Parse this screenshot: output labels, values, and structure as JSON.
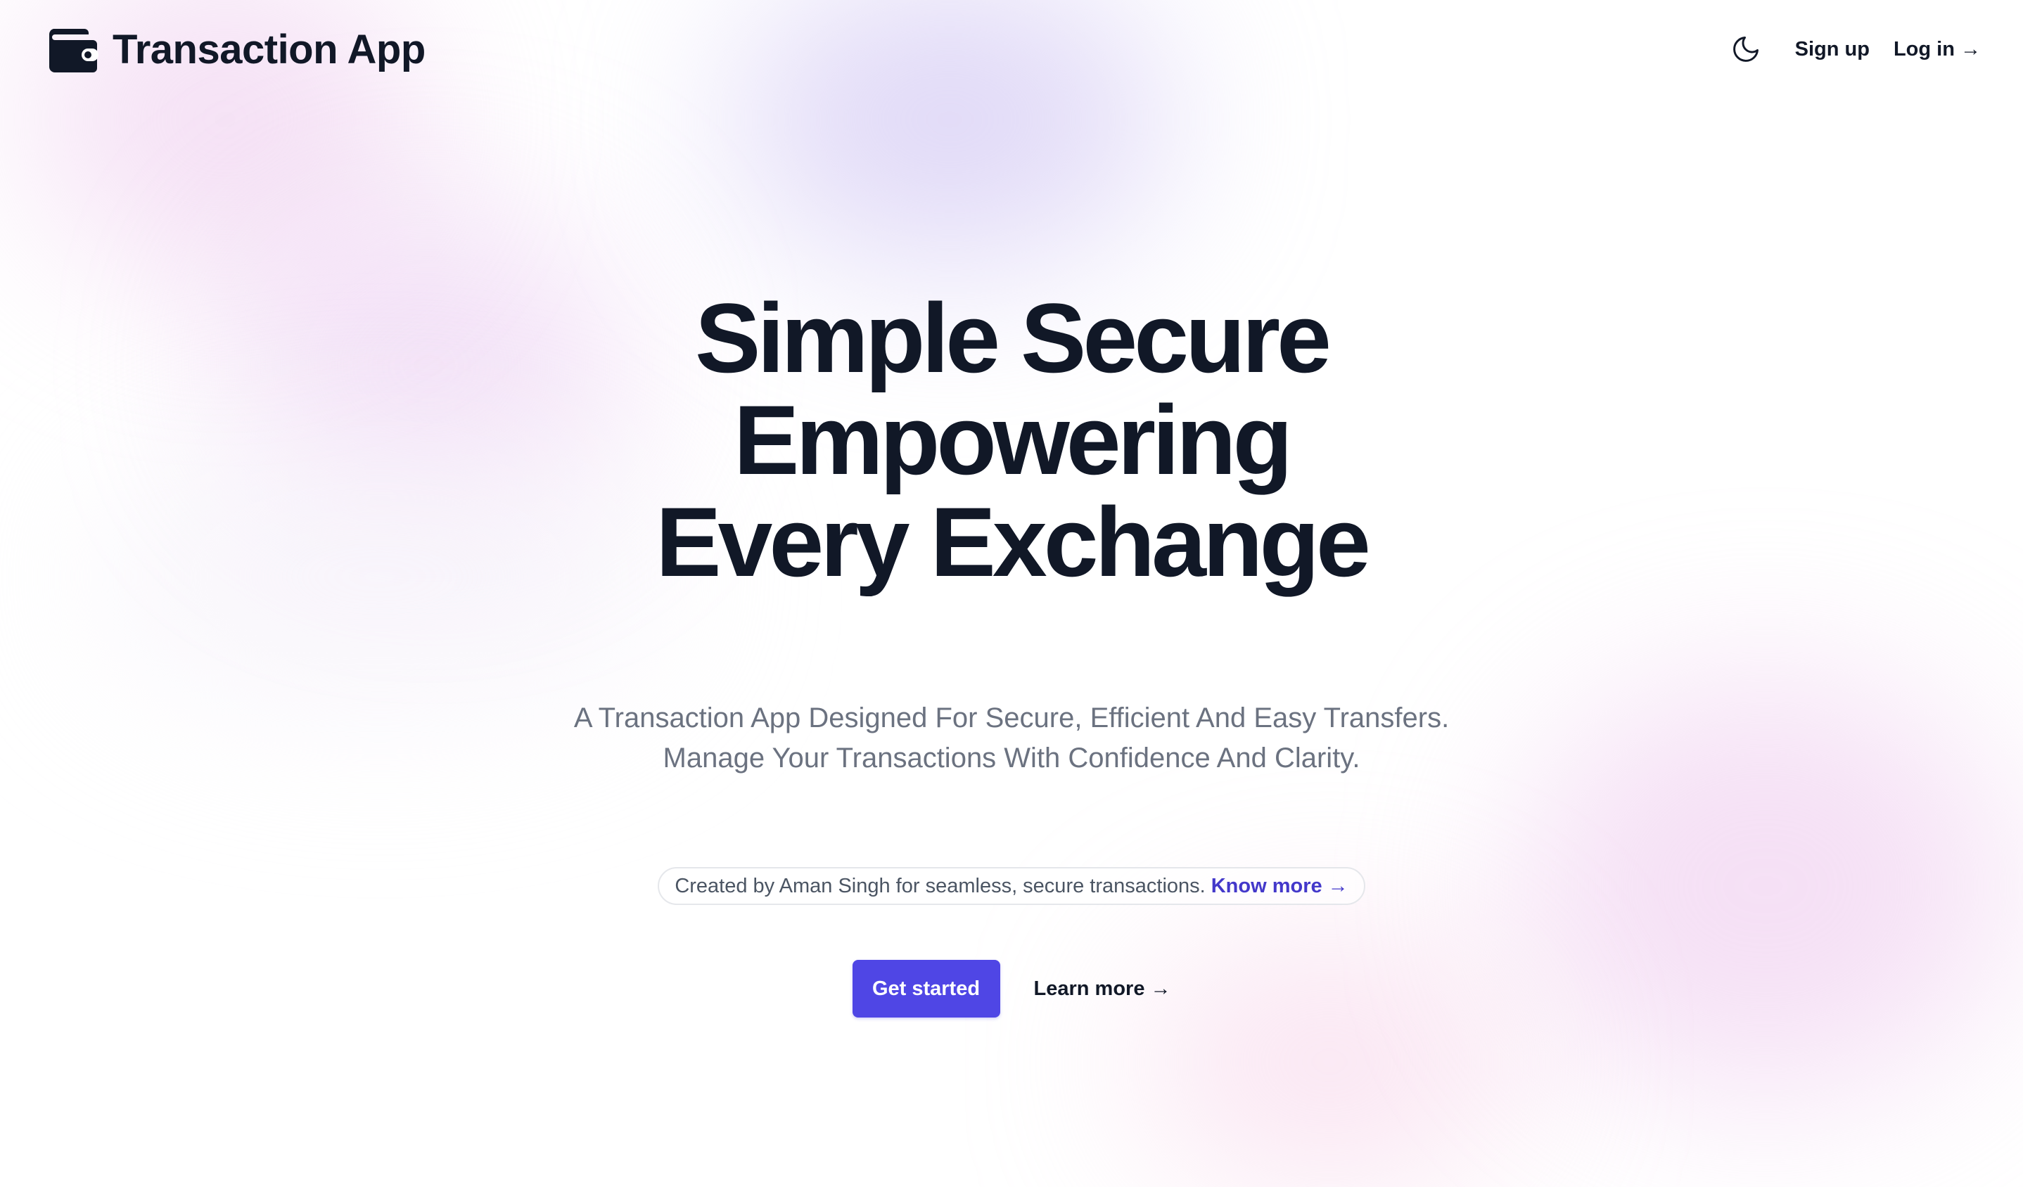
{
  "brand": {
    "title": "Transaction App",
    "icon": "wallet-icon"
  },
  "nav": {
    "theme_icon": "moon-icon",
    "signup_label": "Sign up",
    "login_label": "Log in →"
  },
  "hero": {
    "title_lines": [
      "Simple Secure",
      "Empowering",
      "Every Exchange"
    ],
    "subtitle_lines": [
      "A Transaction App Designed For Secure, Efficient And Easy Transfers.",
      "Manage Your Transactions With Confidence And Clarity."
    ],
    "credit_text": "Created by Aman Singh for seamless, secure transactions.",
    "credit_link": "Know more →",
    "primary_cta": "Get started",
    "secondary_cta": "Learn more →"
  },
  "colors": {
    "accent": "#4f46e5",
    "link": "#4338ca",
    "text": "#111827",
    "muted": "#6b7280"
  }
}
